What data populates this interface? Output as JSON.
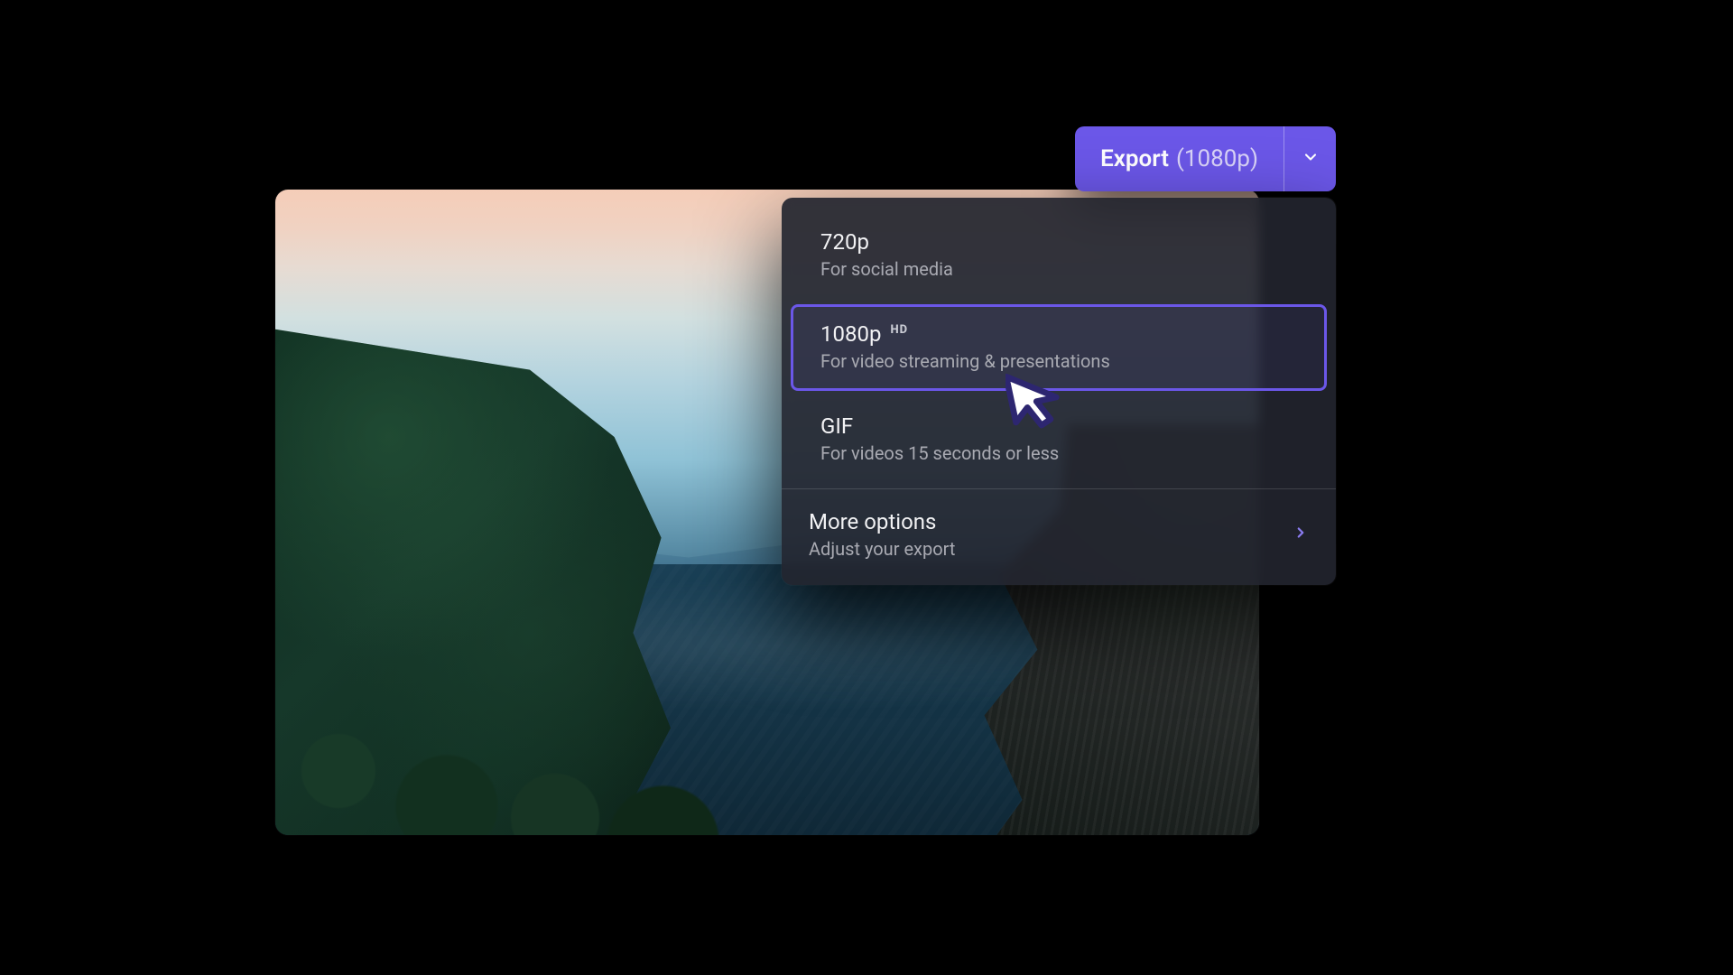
{
  "export_button": {
    "label": "Export",
    "current_resolution": "(1080p)"
  },
  "dropdown": {
    "options": [
      {
        "title": "720p",
        "subtitle": "For social media",
        "badge": ""
      },
      {
        "title": "1080p",
        "subtitle": "For video streaming & presentations",
        "badge": "HD"
      },
      {
        "title": "GIF",
        "subtitle": "For videos 15 seconds or less",
        "badge": ""
      }
    ],
    "selected_index": 1,
    "more": {
      "title": "More options",
      "subtitle": "Adjust your export"
    }
  },
  "colors": {
    "accent": "#6b57e8",
    "panel": "#22242e"
  }
}
